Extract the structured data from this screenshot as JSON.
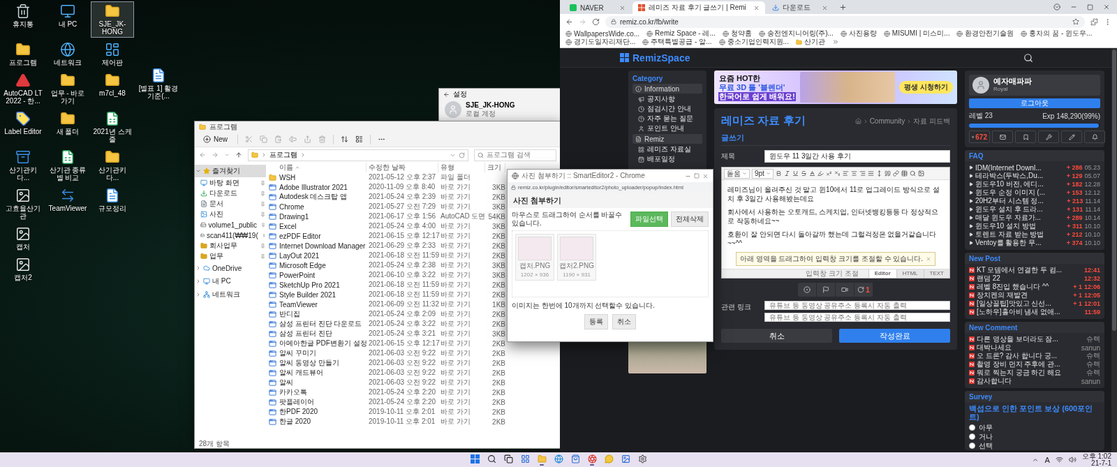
{
  "desktop": {
    "rows": [
      [
        {
          "label": "휴지통",
          "kind": "recycle",
          "selected": false
        },
        {
          "label": "내 PC",
          "kind": "pc",
          "selected": false
        },
        {
          "label": "SJE_JK-HONG",
          "kind": "folder",
          "selected": true
        }
      ],
      [
        {
          "label": "프로그램",
          "kind": "folder",
          "selected": false
        },
        {
          "label": "네트워크",
          "kind": "network",
          "selected": false
        },
        {
          "label": "제어판",
          "kind": "control",
          "selected": false
        }
      ],
      [
        {
          "label": "AutoCAD LT 2022 - 한...",
          "kind": "autocad",
          "selected": false
        },
        {
          "label": "업무 - 바로 가기",
          "kind": "folder",
          "selected": false
        },
        {
          "label": "m7cl_48",
          "kind": "folder",
          "selected": false
        }
      ],
      [
        {
          "label": "Label Editor",
          "kind": "label",
          "selected": false
        },
        {
          "label": "새 폴더",
          "kind": "folder",
          "selected": false
        },
        {
          "label": "2021년 스케줄",
          "kind": "excel",
          "selected": false
        }
      ],
      [
        {
          "label": "산기관키다...",
          "kind": "zip",
          "selected": false
        },
        {
          "label": "산기관 종류별 비교",
          "kind": "excel",
          "selected": false
        },
        {
          "label": "산기관키다...",
          "kind": "folder",
          "selected": false
        }
      ],
      [
        {
          "label": "고효율산기관",
          "kind": "image",
          "selected": false
        },
        {
          "label": "TeamViewer",
          "kind": "teamviewer",
          "selected": false
        },
        {
          "label": "규모정리",
          "kind": "hwp",
          "selected": false
        }
      ],
      [
        {
          "label": "캡처",
          "kind": "image",
          "selected": false
        }
      ],
      [
        {
          "label": "캡처2",
          "kind": "image",
          "selected": false
        }
      ]
    ],
    "loose_icon": {
      "label": "[별표 1] 활경기준(...",
      "kind": "hwp",
      "selected": false
    }
  },
  "settings_window": {
    "title": "설정",
    "user_name": "SJE_JK-HONG",
    "account_type": "로컬 계정"
  },
  "explorer": {
    "title": "프로그램",
    "new_button": "New",
    "path": "프로그램",
    "search_placeholder": "프로그램 검색",
    "nav": [
      {
        "label": "즐겨찾기",
        "kind": "star",
        "expanded": true,
        "selected": true,
        "children": [
          {
            "label": "바탕 화면",
            "kind": "desktop",
            "pinned": true,
            "selected": false
          },
          {
            "label": "다운로드",
            "kind": "download",
            "pinned": true,
            "selected": false
          },
          {
            "label": "문서",
            "kind": "doc",
            "pinned": true,
            "selected": false
          },
          {
            "label": "사진",
            "kind": "photo",
            "pinned": true,
            "selected": false
          },
          {
            "label": "volume1_public",
            "kind": "drive",
            "pinned": true,
            "selected": false
          },
          {
            "label": "scan411(₩₩19(",
            "kind": "drive",
            "pinned": true,
            "selected": false
          },
          {
            "label": "회사업무",
            "kind": "folder",
            "pinned": true,
            "selected": false
          },
          {
            "label": "업무",
            "kind": "folder",
            "pinned": true,
            "selected": false
          }
        ]
      },
      {
        "label": "OneDrive",
        "kind": "cloud",
        "expanded": false,
        "selected": false
      },
      {
        "label": "내 PC",
        "kind": "pc",
        "expanded": false,
        "selected": false
      },
      {
        "label": "네트워크",
        "kind": "network",
        "expanded": false,
        "selected": false
      }
    ],
    "columns": [
      "이름",
      "수정한 날짜",
      "유형",
      "크기"
    ],
    "rows": [
      {
        "name": "WSH",
        "date": "2021-05-12 오후 2:37",
        "type": "파일 폴더",
        "kind": "folder"
      },
      {
        "name": "Adobe Illustrator 2021",
        "date": "2020-11-09 오후 8:40",
        "type": "바로 가기",
        "size": "3KB",
        "kind": "shortcut"
      },
      {
        "name": "Autodesk 데스크탑 앱",
        "date": "2021-05-24 오후 2:39",
        "type": "바로 가기",
        "size": "2KB",
        "kind": "shortcut"
      },
      {
        "name": "Chrome",
        "date": "2021-05-27 오전 7:29",
        "type": "바로 가기",
        "size": "3KB",
        "kind": "shortcut"
      },
      {
        "name": "Drawing1",
        "date": "2021-06-17 오후 1:56",
        "type": "AutoCAD 도면",
        "size": "54KB",
        "kind": "shortcut"
      },
      {
        "name": "Excel",
        "date": "2021-05-24 오후 4:00",
        "type": "바로 가기",
        "size": "3KB",
        "kind": "shortcut"
      },
      {
        "name": "ezPDF Editor",
        "date": "2021-06-15 오후 12:17",
        "type": "바로 가기",
        "size": "2KB",
        "kind": "shortcut"
      },
      {
        "name": "Internet Download Manager",
        "date": "2021-06-29 오후 2:33",
        "type": "바로 가기",
        "size": "2KB",
        "kind": "shortcut"
      },
      {
        "name": "LayOut 2021",
        "date": "2021-06-18 오전 11:59",
        "type": "바로 가기",
        "size": "2KB",
        "kind": "shortcut"
      },
      {
        "name": "Microsoft Edge",
        "date": "2021-05-24 오후 2:38",
        "type": "바로 가기",
        "size": "3KB",
        "kind": "shortcut"
      },
      {
        "name": "PowerPoint",
        "date": "2021-06-10 오후 3:22",
        "type": "바로 가기",
        "size": "3KB",
        "kind": "shortcut"
      },
      {
        "name": "SketchUp Pro 2021",
        "date": "2021-06-18 오전 11:59",
        "type": "바로 가기",
        "size": "2KB",
        "kind": "shortcut"
      },
      {
        "name": "Style Builder 2021",
        "date": "2021-06-18 오전 11:59",
        "type": "바로 가기",
        "size": "2KB",
        "kind": "shortcut"
      },
      {
        "name": "TeamViewer",
        "date": "2021-06-09 오전 11:32",
        "type": "바로 가기",
        "size": "1KB",
        "kind": "shortcut"
      },
      {
        "name": "반디집",
        "date": "2021-05-24 오후 2:09",
        "type": "바로 가기",
        "size": "2KB",
        "kind": "shortcut"
      },
      {
        "name": "삼성 프린터 진단 다운로드",
        "date": "2021-05-24 오후 3:22",
        "type": "바로 가기",
        "size": "2KB",
        "kind": "shortcut"
      },
      {
        "name": "삼성 프린터 진단",
        "date": "2021-05-24 오후 3:21",
        "type": "바로 가기",
        "size": "3KB",
        "kind": "shortcut"
      },
      {
        "name": "아메아한글 PDF변환기 설정",
        "date": "2021-06-15 오후 12:17",
        "type": "바로 가기",
        "size": "2KB",
        "kind": "shortcut"
      },
      {
        "name": "알씨 꾸미기",
        "date": "2021-06-03 오전 9:22",
        "type": "바로 가기",
        "size": "2KB",
        "kind": "shortcut"
      },
      {
        "name": "알씨 동영상 만들기",
        "date": "2021-06-03 오전 9:22",
        "type": "바로 가기",
        "size": "2KB",
        "kind": "shortcut"
      },
      {
        "name": "알씨 캐드뷰어",
        "date": "2021-06-03 오전 9:22",
        "type": "바로 가기",
        "size": "2KB",
        "kind": "shortcut"
      },
      {
        "name": "알씨",
        "date": "2021-06-03 오전 9:22",
        "type": "바로 가기",
        "size": "2KB",
        "kind": "shortcut"
      },
      {
        "name": "카카오톡",
        "date": "2021-05-24 오후 2:20",
        "type": "바로 가기",
        "size": "2KB",
        "kind": "shortcut"
      },
      {
        "name": "팟플레이어",
        "date": "2021-05-24 오후 2:20",
        "type": "바로 가기",
        "size": "2KB",
        "kind": "shortcut"
      },
      {
        "name": "한PDF 2020",
        "date": "2019-10-11 오후 2:01",
        "type": "바로 가기",
        "size": "2KB",
        "kind": "shortcut"
      },
      {
        "name": "한글 2020",
        "date": "2019-10-11 오후 2:01",
        "type": "바로 가기",
        "size": "2KB",
        "kind": "shortcut"
      }
    ],
    "status": "28개 항목"
  },
  "popup": {
    "title": "사진 첨부하기 :: SmartEditor2 - Chrome",
    "url": "remiz.co.kr/plugin/editor/smarteditor2/photo_uploader/popup/index.html",
    "heading": "사진 첨부하기",
    "hint": "마우스로 드래그하여 순서를 바꿀수 있습니다.",
    "select_button": "파일선택",
    "clear_button": "전체삭제",
    "files": [
      {
        "name": "캡처.PNG",
        "dimensions": "1202 × 936"
      },
      {
        "name": "캡처2.PNG",
        "dimensions": "1190 × 931"
      }
    ],
    "limit_note": "이미지는 한번에 10개까지 선택할수 있습니다.",
    "buttons": [
      "등록",
      "취소"
    ]
  },
  "browser": {
    "tabs": [
      {
        "label": "NAVER",
        "kind": "naver",
        "selected": false
      },
      {
        "label": "레미즈 자료 후기 글쓰기 | Remi",
        "kind": "remiz",
        "selected": true
      },
      {
        "label": "다운로드",
        "kind": "download",
        "selected": false
      }
    ],
    "url": "remiz.co.kr/fb/write",
    "bookmarks": [
      {
        "label": "WallpapersWide.co...",
        "kind": "page"
      },
      {
        "label": "Remiz Space - 레...",
        "kind": "page"
      },
      {
        "label": "청약홈",
        "kind": "page"
      },
      {
        "label": "송전엔지니어링(주)...",
        "kind": "page"
      },
      {
        "label": "사진용량",
        "kind": "page"
      },
      {
        "label": "MISUMI | 미스미...",
        "kind": "page"
      },
      {
        "label": "환경안전기술원",
        "kind": "page"
      },
      {
        "label": "홍차의 꿈 - 윈도우...",
        "kind": "page"
      },
      {
        "label": "경기도일자리재단...",
        "kind": "page"
      },
      {
        "label": "주택특별공급 - 알...",
        "kind": "page"
      },
      {
        "label": "중소기업인력지원...",
        "kind": "page"
      },
      {
        "label": "산기관",
        "kind": "folder"
      }
    ],
    "site": {
      "logo": "RemizSpace",
      "sidebar": {
        "title": "Category",
        "groups": [
          {
            "label": "Information",
            "kind": "info",
            "items": [
              {
                "label": "공지사항",
                "kind": "megaphone"
              },
              {
                "label": "점검시간 안내",
                "kind": "clock"
              },
              {
                "label": "자주 묻는 질문",
                "kind": "help"
              },
              {
                "label": "포인트 안내",
                "kind": "user"
              }
            ]
          },
          {
            "label": "Remiz",
            "kind": "file",
            "items": [
              {
                "label": "레미즈 자료실",
                "kind": "grid"
              },
              {
                "label": "배포일정",
                "kind": "calendar"
              }
            ]
          }
        ]
      },
      "ad_banner": {
        "tagline": "요즘 HOT한",
        "title": "무료 3D 툴 '블렌더'",
        "subtitle": "한국어로 쉽게 배워요!",
        "cta": "평생 시청하기"
      },
      "board": {
        "title": "레미즈 자료 후기",
        "breadcrumb": [
          "Community",
          "자료 피드백"
        ],
        "section": "글쓰기",
        "subject_label": "제목",
        "subject_value": "윈도우 11 3일간 사용 후기",
        "font_name": "돋움",
        "font_size": "9pt",
        "paragraphs": [
          "레미즈님이 올려주신 것 말고 윈10에서 11로 업그레이드 방식으로 설치 후 3일간 사용해봤는데요",
          "회사에서 사용하는 오토캐드, 스케치업, 인터넷뱅킹등등 다 정상적으로 작동하네요~~",
          "호환이 잘 안되면 다시 돌아갈까 했는데 그럴걱정은 없을거같습니다~~^^"
        ],
        "resize_tip": "아래 영역을 드래그하여 입력창 크기를 조절할 수 있습니다.",
        "resize_label": "입력창 크기 조절",
        "editor_modes": [
          {
            "label": "Editor",
            "selected": true
          },
          {
            "label": "HTML",
            "selected": false
          },
          {
            "label": "TEXT",
            "selected": false
          }
        ],
        "refresh_count": "1",
        "link_label": "관련 링크",
        "link_placeholders": [
          "유튜브 등 동영상 공유주소 등록시 자동 출력",
          "유튜브 등 동영상 공유주소 등록시 자동 출력"
        ],
        "cancel_button": "취소",
        "submit_button": "작성완료"
      },
      "profile": {
        "name": "예자매파파",
        "rank": "Royal",
        "logout_button": "로그아웃",
        "level_label": "레벨 23",
        "exp": "Exp 148,290(99%)",
        "level": 0.99,
        "points": "672"
      },
      "faq": {
        "title": "FAQ",
        "items": [
          {
            "title": "IDM(Internet Downl...",
            "count": "+ 286",
            "time": "05.23"
          },
          {
            "title": "테라박스(두박스,Du...",
            "count": "+ 129",
            "time": "05.07"
          },
          {
            "title": "윈도우10 버전, 에디...",
            "count": "+ 182",
            "time": "12.28"
          },
          {
            "title": "윈도우 순정 이미지 (...",
            "count": "+ 153",
            "time": "12.12"
          },
          {
            "title": "20H2부터 시스템 정...",
            "count": "+ 213",
            "time": "11.14"
          },
          {
            "title": "윈도우 설치 후 드라...",
            "count": "+ 131",
            "time": "11.14"
          },
          {
            "title": "매달 윈도우 자료가...",
            "count": "+ 289",
            "time": "10.14"
          },
          {
            "title": "윈도우10 설치 방법",
            "count": "+ 311",
            "time": "10.10"
          },
          {
            "title": "토렌트 자료 받는 방법",
            "count": "+ 212",
            "time": "10.10"
          },
          {
            "title": "Ventoy를 활용한 무...",
            "count": "+ 374",
            "time": "10.10"
          }
        ]
      },
      "new_post": {
        "title": "New Post",
        "items": [
          {
            "title": "KT 모뎀에서 연결한 두 컴...",
            "time": "12:41"
          },
          {
            "title": "랜덤 22",
            "time": "12:32"
          },
          {
            "title": "레벨 8진입 했습니다 ^^",
            "count": "+ 1",
            "time": "12:06"
          },
          {
            "title": "장치켄의 재발견",
            "count": "+ 1",
            "time": "12:05"
          },
          {
            "title": "[일상꿀팁]맛있고 신선...",
            "count": "+ 1",
            "time": "12:01"
          },
          {
            "title": "[노하우]홀아비 냄새 없애...",
            "time": "11:59"
          }
        ]
      },
      "new_comment": {
        "title": "New Comment",
        "items": [
          {
            "title": "다른 영상을 보더라도 잠...",
            "author": "슈렉"
          },
          {
            "title": "대박나세요",
            "author": "sanun"
          },
          {
            "title": "오 드론? 감사 합니다 궁...",
            "author": "슈렉"
          },
          {
            "title": "촬영 장비 먼지 주후에 관...",
            "author": "슈렉"
          },
          {
            "title": "뭐로 찍는지 궁금 하긴 해요",
            "author": "슈렉"
          },
          {
            "title": "감사합니다",
            "author": "sanun"
          }
        ]
      },
      "survey": {
        "title": "Survey",
        "question": "백섭으로 인한 포인트 보상 (600포인트)",
        "options": [
          {
            "label": "아무",
            "selected": false
          },
          {
            "label": "거나",
            "selected": false
          },
          {
            "label": "선택",
            "selected": false
          }
        ]
      }
    }
  },
  "taskbar": {
    "apps": [
      {
        "kind": "start",
        "active": false
      },
      {
        "kind": "search",
        "active": false
      },
      {
        "kind": "taskview",
        "active": false
      },
      {
        "kind": "widgets",
        "active": false
      },
      {
        "kind": "explorer",
        "active": true
      },
      {
        "kind": "edge",
        "active": false
      },
      {
        "kind": "store",
        "active": false
      },
      {
        "kind": "chrome",
        "active": true
      },
      {
        "kind": "kakao",
        "active": false
      },
      {
        "kind": "photos",
        "active": false
      },
      {
        "kind": "settings",
        "active": false
      }
    ],
    "language": "A",
    "time": "오후 1:02",
    "date": "21-7-1"
  }
}
